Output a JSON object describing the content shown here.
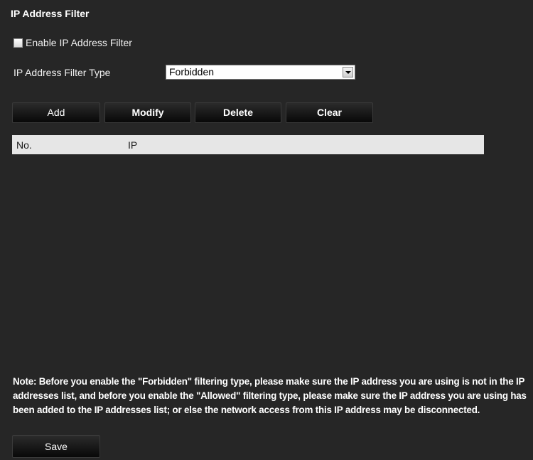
{
  "section": {
    "title": "IP Address Filter"
  },
  "enable_filter": {
    "label": "Enable IP Address Filter",
    "checked": false
  },
  "filter_type": {
    "label": "IP Address Filter Type",
    "value": "Forbidden"
  },
  "toolbar": {
    "add_label": "Add",
    "modify_label": "Modify",
    "delete_label": "Delete",
    "clear_label": "Clear"
  },
  "table": {
    "columns": [
      "No.",
      "IP"
    ],
    "rows": []
  },
  "note": "Note: Before you enable the \"Forbidden\" filtering type, please make sure the IP address you are using is not in the IP addresses list, and before you enable the \"Allowed\" filtering type, please make sure the IP address you are using has been added to the IP addresses list; or else the network access from this IP address may be disconnected.",
  "footer": {
    "save_label": "Save"
  }
}
